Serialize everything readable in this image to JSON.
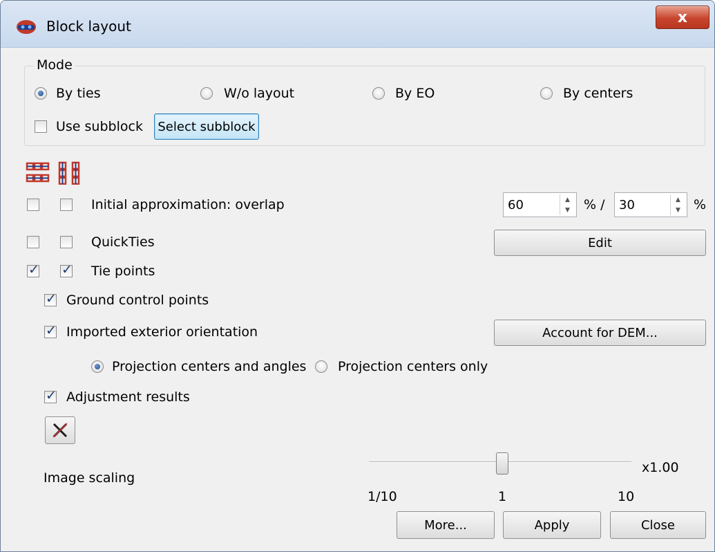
{
  "window": {
    "title": "Block layout",
    "close_glyph": "x",
    "icon": "app-logo-icon"
  },
  "mode": {
    "legend": "Mode",
    "options": [
      {
        "label": "By ties",
        "selected": true
      },
      {
        "label": "W/o layout",
        "selected": false
      },
      {
        "label": "By EO",
        "selected": false
      },
      {
        "label": "By centers",
        "selected": false
      }
    ],
    "use_subblock": {
      "label": "Use subblock",
      "checked": false
    },
    "select_subblock_label": "Select subblock"
  },
  "toolbar": {
    "icons": [
      "horizontal-strips-icon",
      "vertical-strips-icon"
    ]
  },
  "initial_approximation": {
    "label": "Initial approximation: overlap",
    "check_a": false,
    "check_b": false,
    "overlap_value": "60",
    "separator": "% /",
    "sidelap_value": "30",
    "unit": "%"
  },
  "quickties": {
    "label": "QuickTies",
    "check_a": false,
    "check_b": false,
    "edit_label": "Edit"
  },
  "tie_points": {
    "label": "Tie points",
    "check_a": true,
    "check_b": true
  },
  "gcp": {
    "label": "Ground control points",
    "checked": true
  },
  "imported_eo": {
    "label": "Imported exterior orientation",
    "checked": true,
    "account_dem_label": "Account for DEM...",
    "options": [
      {
        "label": "Projection centers and angles",
        "selected": true
      },
      {
        "label": "Projection centers only",
        "selected": false
      }
    ]
  },
  "adjustment": {
    "label": "Adjustment results",
    "checked": true
  },
  "clear_icon": "clear-cross-icon",
  "image_scaling": {
    "label": "Image scaling",
    "value_text": "x1.00",
    "min_label": "1/10",
    "mid_label": "1",
    "max_label": "10",
    "value": 1.0
  },
  "footer": {
    "more_label": "More...",
    "apply_label": "Apply",
    "close_label": "Close"
  }
}
